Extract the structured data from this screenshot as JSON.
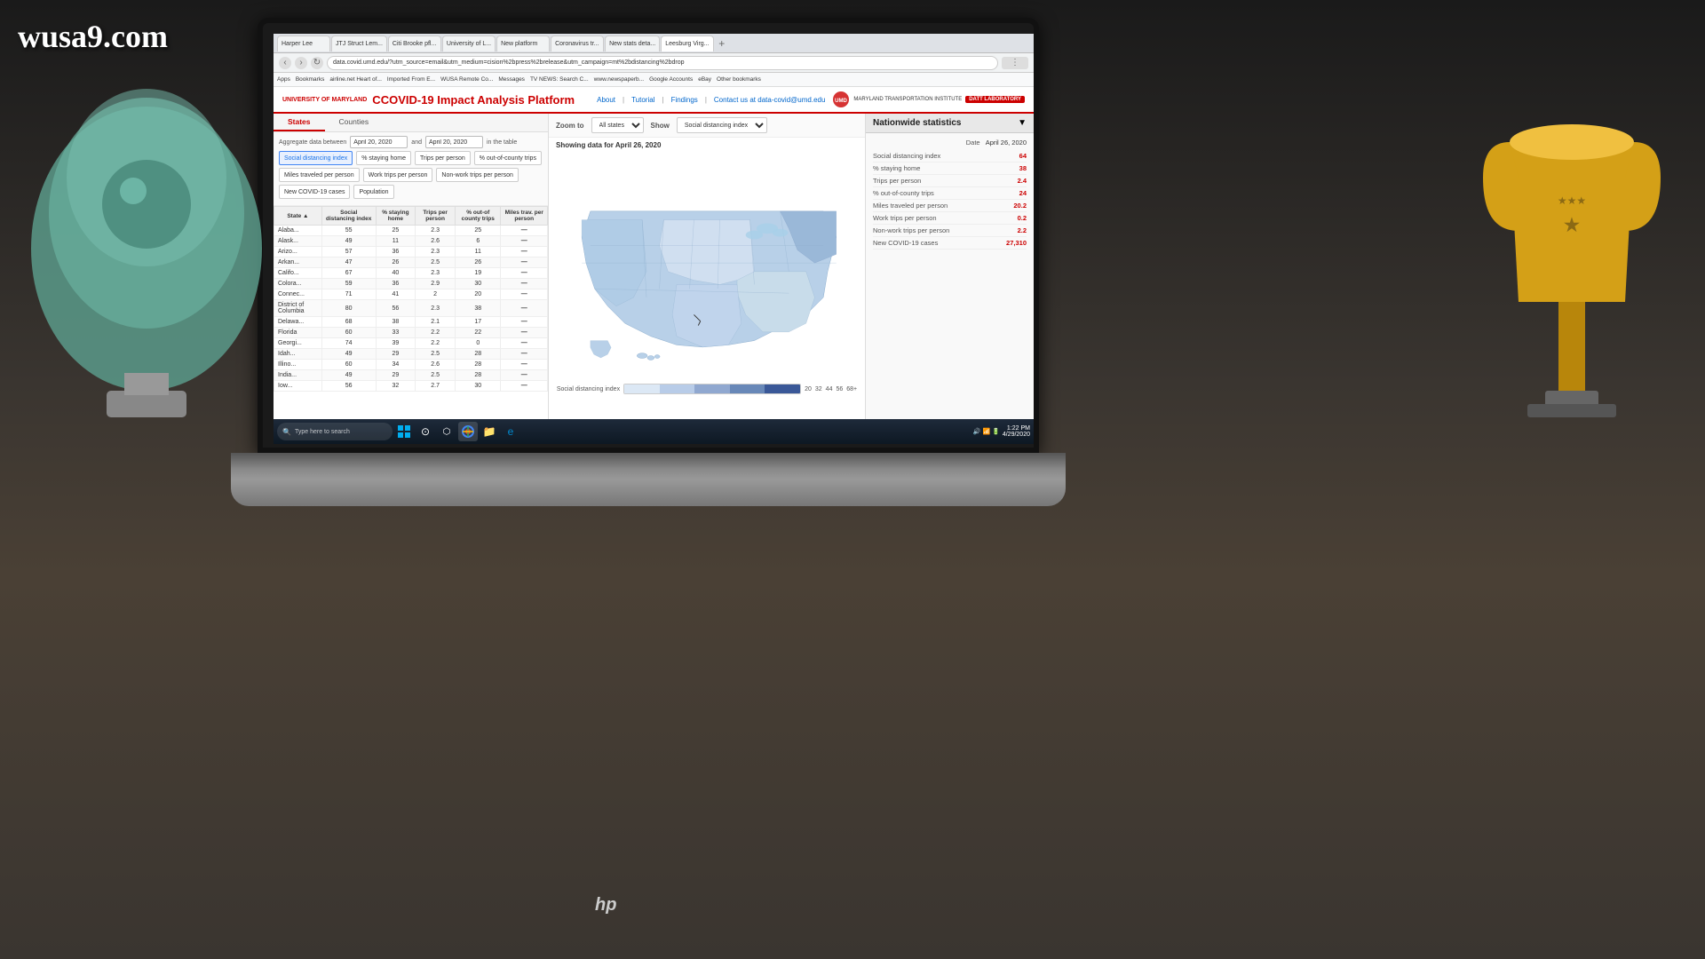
{
  "scene": {
    "wusa_logo": "wusa9.com",
    "hp_logo": "hp"
  },
  "browser": {
    "tabs": [
      {
        "label": "Harper Lee",
        "active": false
      },
      {
        "label": "JTJ Struct Lem...",
        "active": false
      },
      {
        "label": "Citi Brooke pfl...",
        "active": false
      },
      {
        "label": "University of L...",
        "active": false
      },
      {
        "label": "New platform",
        "active": false
      },
      {
        "label": "Coronavirus tr...",
        "active": false
      },
      {
        "label": "New stats deta...",
        "active": false
      },
      {
        "label": "Leesburg Virg...",
        "active": true
      }
    ],
    "address": "data.covid.umd.edu/?utm_source=email&utm_medium=cision%2bpress%2brelease&utm_campaign=mt%2bdistancing%2bdrop",
    "bookmarks": [
      "Apps",
      "Bookmarks",
      "airline.net Heart of...",
      "Imported From E...",
      "WUSA Remote Co...",
      "Messages",
      "TV NEWS: Search C...",
      "www.newspaperb...",
      "Google Accounts",
      "eBay",
      "Other bookmarks"
    ]
  },
  "site": {
    "university_label": "UNIVERSITY OF MARYLAND",
    "title": "COVID-19 Impact Analysis Platform",
    "nav_items": [
      "About",
      "Tutorial",
      "Findings",
      "Contact us at data-covid@umd.edu"
    ],
    "umd_label": "MARYLAND TRANSPORTATION INSTITUTE",
    "datt_label": "DATT LABORATORY",
    "showing_data": "Showing data for April 26, 2020",
    "tabs": [
      "States",
      "Counties"
    ],
    "active_tab": "States",
    "filter": {
      "aggregate_label": "Aggregate data between",
      "date_from": "April 20, 2020",
      "and_label": "and",
      "date_to": "April 20, 2020",
      "in_the_table": "in the table",
      "buttons": [
        "Social distancing index",
        "% staying home",
        "Trips per person",
        "% out-of-county trips",
        "Miles traveled per person",
        "Work trips per person",
        "Non-work trips per person",
        "New COVID-19 cases",
        "Population"
      ],
      "active_button": "Social distancing index"
    },
    "table": {
      "headers": [
        "State ▲",
        "Social distancing index",
        "% staying home",
        "Trips per person",
        "% out-of county trips",
        "Miles traveled per person"
      ],
      "rows": [
        {
          "state": "Alaba...",
          "sdi": "55",
          "psh": "25",
          "tpp": "2.3",
          "ooc": "25",
          "miles": "—"
        },
        {
          "state": "Alask...",
          "sdi": "49",
          "psh": "11",
          "tpp": "2.6",
          "ooc": "6",
          "miles": "—"
        },
        {
          "state": "Arizo...",
          "sdi": "57",
          "psh": "36",
          "tpp": "2.3",
          "ooc": "11",
          "miles": "—"
        },
        {
          "state": "Arkan...",
          "sdi": "47",
          "psh": "26",
          "tpp": "2.5",
          "ooc": "26",
          "miles": "—"
        },
        {
          "state": "Califo...",
          "sdi": "67",
          "psh": "40",
          "tpp": "2.3",
          "ooc": "19",
          "miles": "—"
        },
        {
          "state": "Colora...",
          "sdi": "59",
          "psh": "36",
          "tpp": "2.9",
          "ooc": "30",
          "miles": "—"
        },
        {
          "state": "Connec...",
          "sdi": "71",
          "psh": "41",
          "tpp": "2",
          "ooc": "20",
          "miles": "—"
        },
        {
          "state": "District of Columbia",
          "sdi": "80",
          "psh": "56",
          "tpp": "2.3",
          "ooc": "38",
          "miles": "—"
        },
        {
          "state": "Delawa...",
          "sdi": "68",
          "psh": "38",
          "tpp": "2.1",
          "ooc": "17",
          "miles": "—"
        },
        {
          "state": "Florida",
          "sdi": "60",
          "psh": "33",
          "tpp": "2.2",
          "ooc": "22",
          "miles": "—"
        },
        {
          "state": "Georgi...",
          "sdi": "74",
          "psh": "39",
          "tpp": "2.2",
          "ooc": "0",
          "miles": "—"
        },
        {
          "state": "Idah...",
          "sdi": "49",
          "psh": "29",
          "tpp": "2.5",
          "ooc": "28",
          "miles": "—"
        },
        {
          "state": "Illino...",
          "sdi": "60",
          "psh": "34",
          "tpp": "2.6",
          "ooc": "28",
          "miles": "—"
        },
        {
          "state": "India...",
          "sdi": "49",
          "psh": "29",
          "tpp": "2.5",
          "ooc": "28",
          "miles": "—"
        },
        {
          "state": "Iow...",
          "sdi": "56",
          "psh": "32",
          "tpp": "2.7",
          "ooc": "30",
          "miles": "—"
        }
      ]
    },
    "map": {
      "zoom_label": "Zoom to",
      "zoom_value": "All states",
      "show_label": "Show",
      "show_value": "Social distancing index"
    },
    "stats": {
      "title": "Nationwide statistics",
      "date_label": "Date",
      "date_value": "April 26, 2020",
      "items": [
        {
          "label": "Social distancing index",
          "value": "64"
        },
        {
          "label": "% staying home",
          "value": "38"
        },
        {
          "label": "Trips per person",
          "value": "2.4"
        },
        {
          "label": "% out-of-county trips",
          "value": "24"
        },
        {
          "label": "Miles traveled per person",
          "value": "20.2"
        },
        {
          "label": "Work trips per person",
          "value": "0.2"
        },
        {
          "label": "Non-work trips per person",
          "value": "2.2"
        },
        {
          "label": "New COVID-19 cases",
          "value": "27,310"
        }
      ]
    },
    "legend": {
      "label": "Social distancing index",
      "values": [
        "20",
        "32",
        "44",
        "56",
        "68+"
      ]
    }
  },
  "taskbar": {
    "search_placeholder": "Type here to search",
    "clock": "1:22 PM",
    "date": "4/29/2020"
  }
}
